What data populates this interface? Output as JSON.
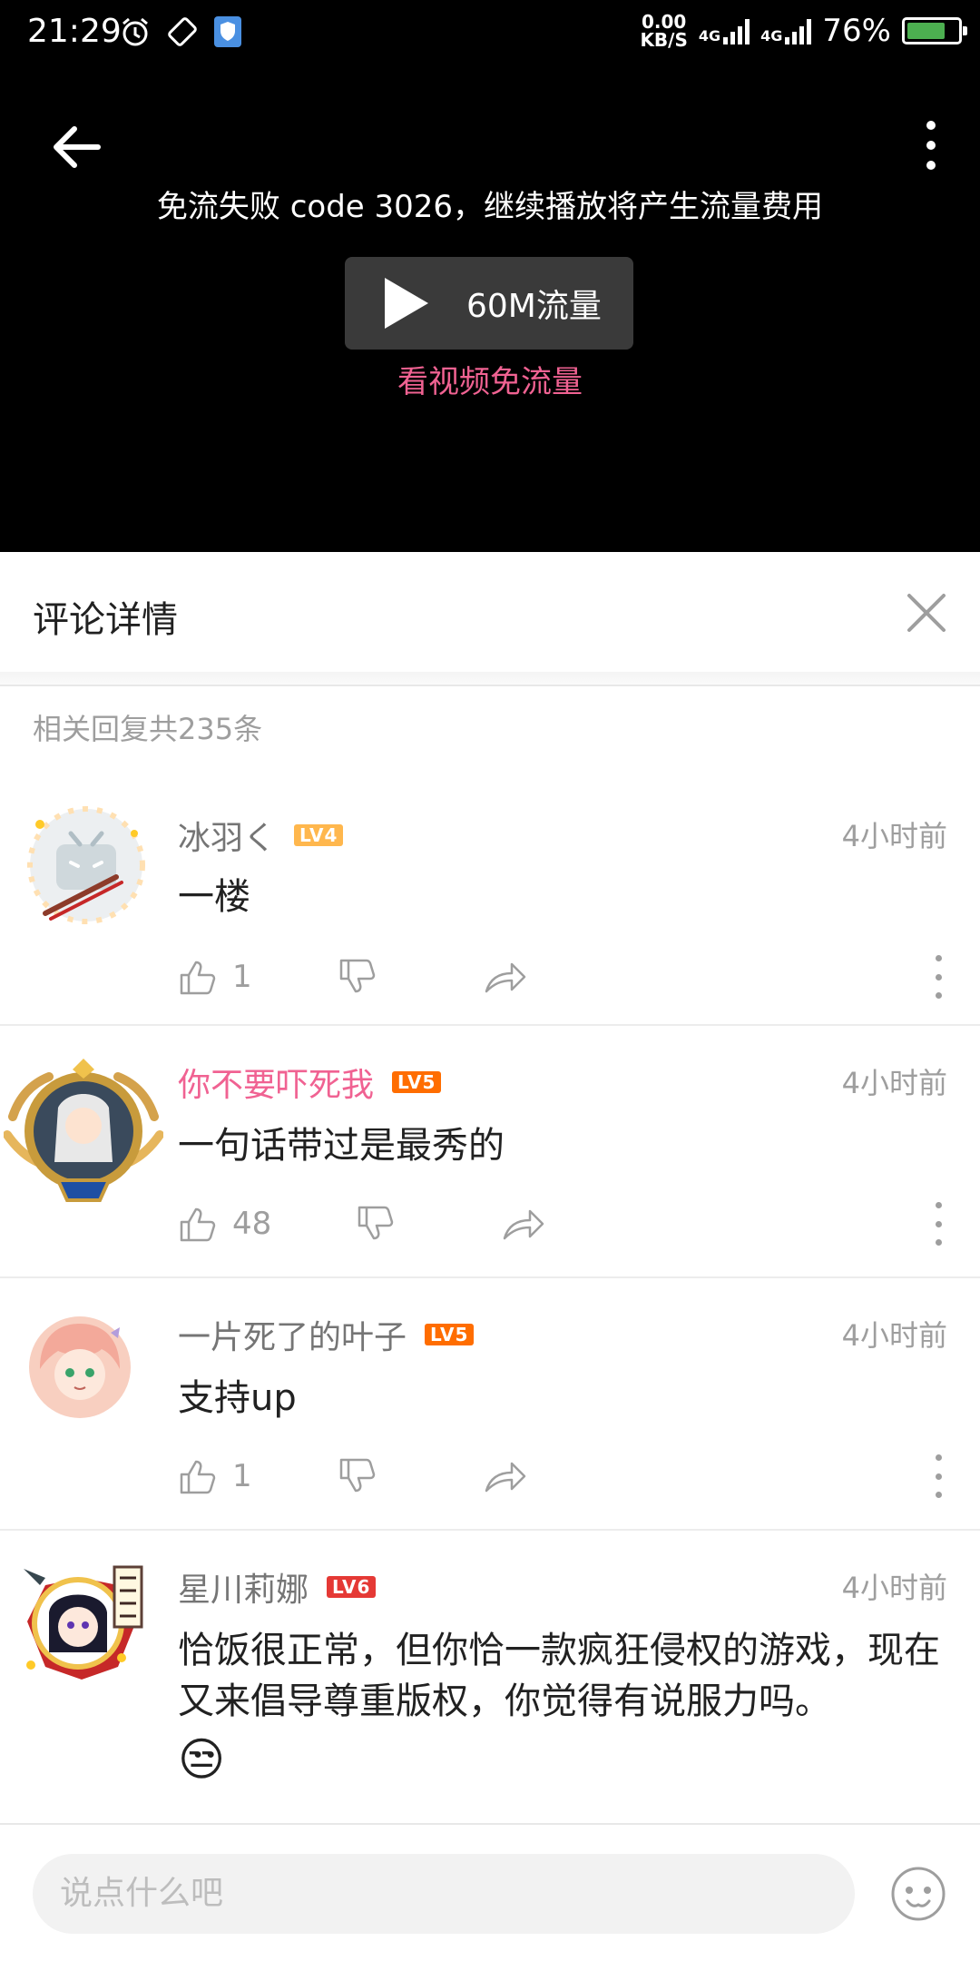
{
  "status_bar": {
    "time": "21:29",
    "speed_value": "0.00",
    "speed_unit": "KB/S",
    "net1": "4G",
    "net2": "4G",
    "battery_percent": "76%",
    "battery_level": 0.76,
    "battery_color": "#4caf50"
  },
  "video": {
    "error_message": "免流失败 code 3026，继续播放将产生流量费用",
    "play_label": "60M流量",
    "free_link": "看视频免流量",
    "link_color": "#f06292"
  },
  "sheet": {
    "title": "评论详情",
    "reply_count": "相关回复共235条"
  },
  "comments": [
    {
      "name": "冰羽く",
      "level": "LV4",
      "time": "4小时前",
      "text": "一楼",
      "likes": "1",
      "avatar_icon": "bilibili-tv-avatar-icon"
    },
    {
      "name": "你不要吓死我",
      "level": "LV5",
      "time": "4小时前",
      "text": "一句话带过是最秀的",
      "likes": "48",
      "name_color": "#f06292",
      "avatar_icon": "anime-girl-framed-avatar-icon"
    },
    {
      "name": "一片死了的叶子",
      "level": "LV5",
      "time": "4小时前",
      "text": "支持up",
      "likes": "1",
      "avatar_icon": "anime-girl-avatar-icon"
    },
    {
      "name": "星川莉娜",
      "level": "LV6",
      "time": "4小时前",
      "text": "恰饭很正常，但你恰一款疯狂侵权的游戏，现在又来倡导尊重版权，你觉得有说服力吗。",
      "emoji": "😒",
      "avatar_icon": "anime-girl-badge-avatar-icon"
    }
  ],
  "input": {
    "placeholder": "说点什么吧"
  }
}
